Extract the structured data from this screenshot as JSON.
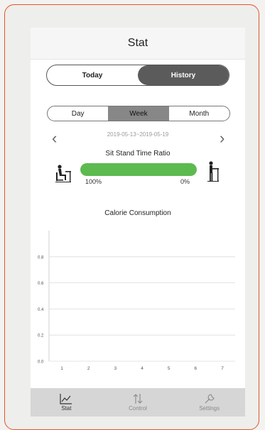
{
  "header": {
    "title": "Stat"
  },
  "view_toggle": {
    "today_label": "Today",
    "history_label": "History",
    "selected": "History"
  },
  "period_tabs": {
    "items": [
      "Day",
      "Week",
      "Month"
    ],
    "selected": "Week"
  },
  "date_range": "2019-05-13~2019-05-19",
  "sit_stand": {
    "title": "Sit Stand Time Ratio",
    "sit_percent_label": "100%",
    "stand_percent_label": "0%",
    "sit_fraction": 1.0
  },
  "calorie_chart": {
    "title": "Calorie Consumption"
  },
  "chart_data": {
    "type": "line",
    "title": "Calorie Consumption",
    "x": [
      "1",
      "2",
      "3",
      "4",
      "5",
      "6",
      "7"
    ],
    "y_ticks": [
      "0.0",
      "0.2",
      "0.4",
      "0.6",
      "0.8"
    ],
    "ylim": [
      0,
      1
    ],
    "series": [],
    "grid": true
  },
  "tabbar": {
    "items": [
      {
        "label": "Stat",
        "icon": "chart-line-icon"
      },
      {
        "label": "Control",
        "icon": "up-down-arrows-icon"
      },
      {
        "label": "Settings",
        "icon": "wrench-icon"
      }
    ]
  },
  "colors": {
    "frame": "#e0552a",
    "bar_fill": "#5cba4f",
    "toggle_active": "#5b5b5b",
    "tabbar": "#d6d6d6"
  }
}
